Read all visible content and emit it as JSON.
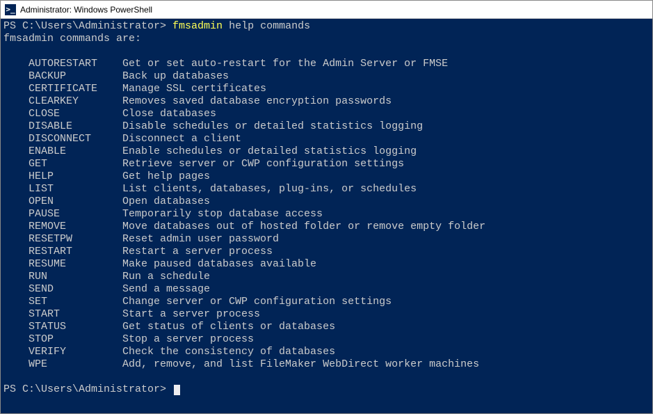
{
  "window": {
    "title": "Administrator: Windows PowerShell",
    "icon_glyph": ">_"
  },
  "prompt1": {
    "prefix": "PS C:\\Users\\Administrator> ",
    "cmd_exe": "fmsadmin",
    "cmd_args": " help commands"
  },
  "header": "fmsadmin commands are:",
  "commands": [
    {
      "name": "AUTORESTART",
      "desc": "Get or set auto-restart for the Admin Server or FMSE"
    },
    {
      "name": "BACKUP",
      "desc": "Back up databases"
    },
    {
      "name": "CERTIFICATE",
      "desc": "Manage SSL certificates"
    },
    {
      "name": "CLEARKEY",
      "desc": "Removes saved database encryption passwords"
    },
    {
      "name": "CLOSE",
      "desc": "Close databases"
    },
    {
      "name": "DISABLE",
      "desc": "Disable schedules or detailed statistics logging"
    },
    {
      "name": "DISCONNECT",
      "desc": "Disconnect a client"
    },
    {
      "name": "ENABLE",
      "desc": "Enable schedules or detailed statistics logging"
    },
    {
      "name": "GET",
      "desc": "Retrieve server or CWP configuration settings"
    },
    {
      "name": "HELP",
      "desc": "Get help pages"
    },
    {
      "name": "LIST",
      "desc": "List clients, databases, plug-ins, or schedules"
    },
    {
      "name": "OPEN",
      "desc": "Open databases"
    },
    {
      "name": "PAUSE",
      "desc": "Temporarily stop database access"
    },
    {
      "name": "REMOVE",
      "desc": "Move databases out of hosted folder or remove empty folder"
    },
    {
      "name": "RESETPW",
      "desc": "Reset admin user password"
    },
    {
      "name": "RESTART",
      "desc": "Restart a server process"
    },
    {
      "name": "RESUME",
      "desc": "Make paused databases available"
    },
    {
      "name": "RUN",
      "desc": "Run a schedule"
    },
    {
      "name": "SEND",
      "desc": "Send a message"
    },
    {
      "name": "SET",
      "desc": "Change server or CWP configuration settings"
    },
    {
      "name": "START",
      "desc": "Start a server process"
    },
    {
      "name": "STATUS",
      "desc": "Get status of clients or databases"
    },
    {
      "name": "STOP",
      "desc": "Stop a server process"
    },
    {
      "name": "VERIFY",
      "desc": "Check the consistency of databases"
    },
    {
      "name": "WPE",
      "desc": "Add, remove, and list FileMaker WebDirect worker machines"
    }
  ],
  "prompt2": {
    "prefix": "PS C:\\Users\\Administrator> "
  }
}
